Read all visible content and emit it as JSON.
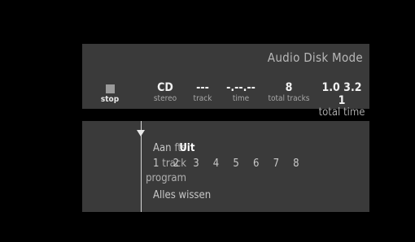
{
  "status_panel": {
    "mode_title": "Audio Disk Mode",
    "stop_label": "stop",
    "disc_type": "CD",
    "disc_type_label": "stereo",
    "track_value": "---",
    "track_label": "track",
    "time_value": "-.--.--",
    "time_label": "time",
    "total_tracks_value": "8",
    "total_tracks_label": "total tracks",
    "total_time_value": "1.0 3.2 1",
    "total_time_label": "total time"
  },
  "settings_panel": {
    "fts_label": "fts",
    "fts_options": [
      "Aan",
      "Uit"
    ],
    "fts_selected": "Uit",
    "track_label": "track",
    "track_numbers": [
      "1",
      "2",
      "3",
      "4",
      "5",
      "6",
      "7",
      "8"
    ],
    "program_label": "program",
    "action_label": "Alles wissen"
  },
  "colors": {
    "panel_bg": "#3a3a3a",
    "background": "#000000",
    "text": "#dcdcdc"
  }
}
